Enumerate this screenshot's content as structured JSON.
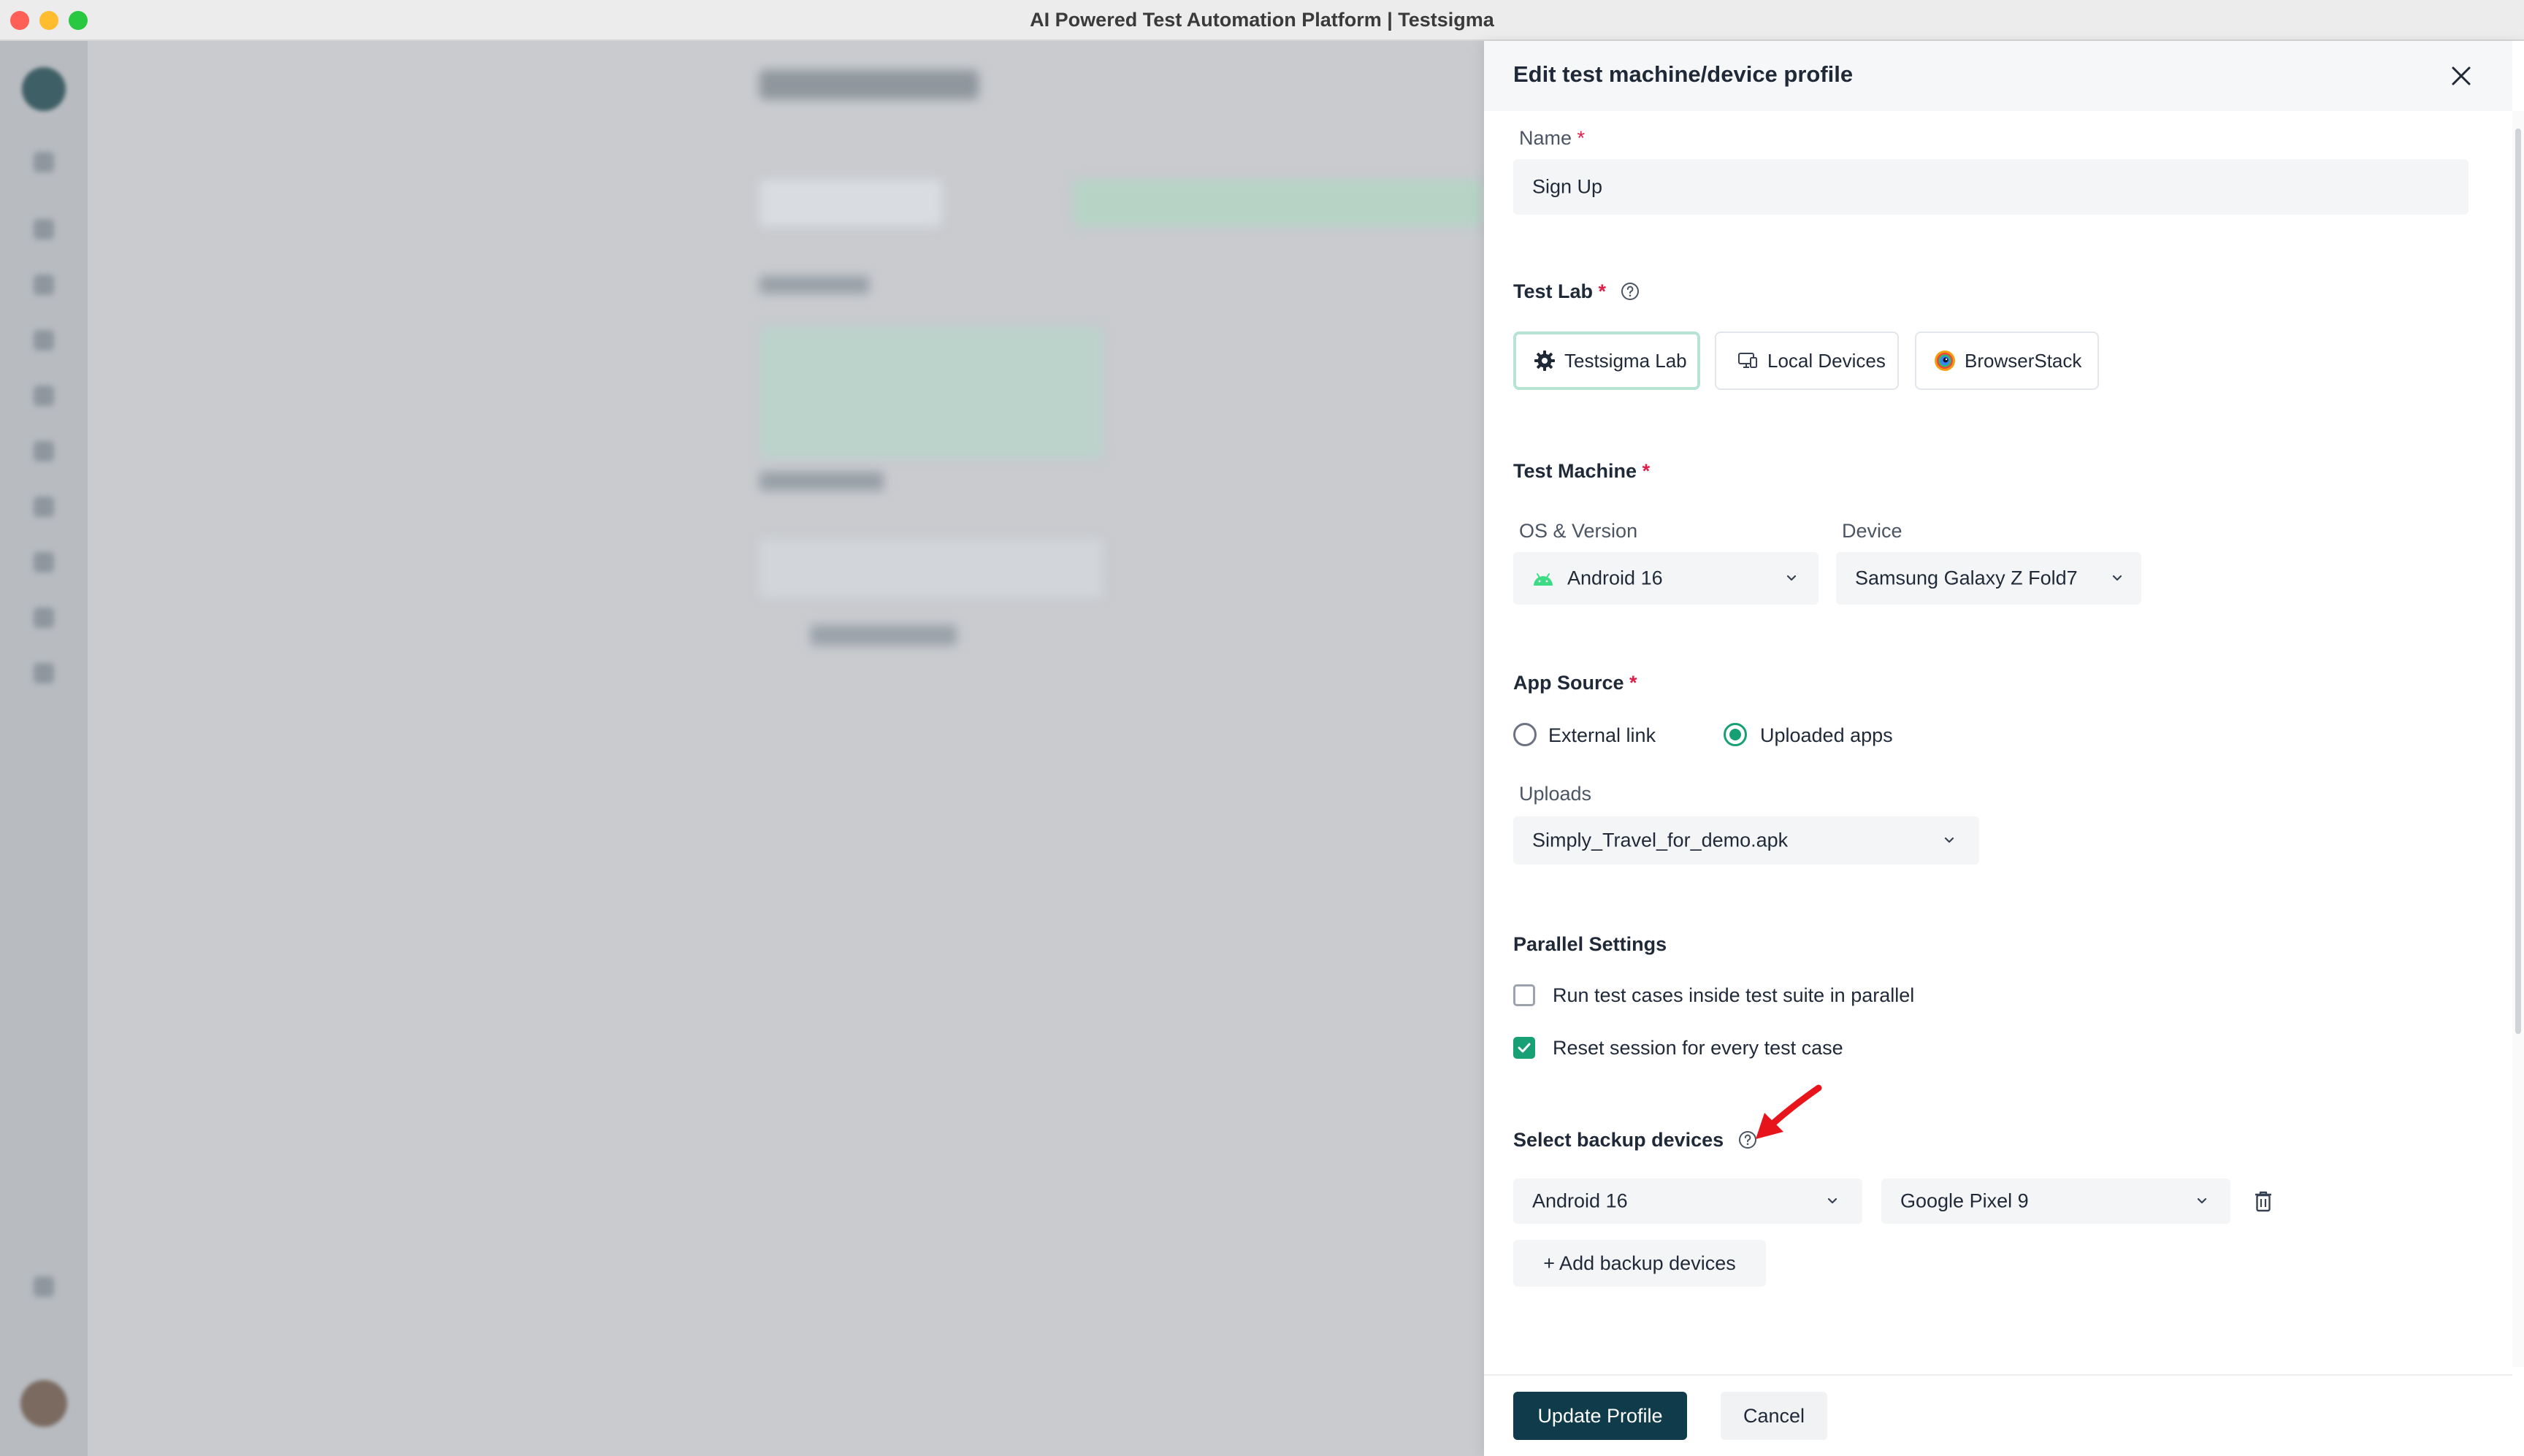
{
  "window": {
    "title": "AI Powered Test Automation Platform | Testsigma"
  },
  "drawer": {
    "title": "Edit test machine/device profile",
    "name_field": {
      "label": "Name",
      "required_mark": "*",
      "value": "Sign Up"
    },
    "test_lab": {
      "label": "Test Lab",
      "required_mark": "*",
      "options": [
        {
          "label": "Testsigma Lab",
          "icon": "gear-icon",
          "selected": true
        },
        {
          "label": "Local Devices",
          "icon": "monitor-icon",
          "selected": false
        },
        {
          "label": "BrowserStack",
          "icon": "browserstack-logo-icon",
          "selected": false
        }
      ]
    },
    "test_machine": {
      "label": "Test Machine",
      "required_mark": "*",
      "os_label": "OS & Version",
      "os_value": "Android 16",
      "device_label": "Device",
      "device_value": "Samsung Galaxy Z Fold7"
    },
    "app_source": {
      "label": "App Source",
      "required_mark": "*",
      "options": [
        {
          "label": "External link",
          "selected": false
        },
        {
          "label": "Uploaded apps",
          "selected": true
        }
      ],
      "uploads_label": "Uploads",
      "uploads_value": "Simply_Travel_for_demo.apk"
    },
    "parallel": {
      "label": "Parallel Settings",
      "options": [
        {
          "label": "Run test cases inside test suite in parallel",
          "checked": false
        },
        {
          "label": "Reset session for every test case",
          "checked": true
        }
      ]
    },
    "backup": {
      "label": "Select backup devices",
      "os_value": "Android 16",
      "device_value": "Google Pixel 9",
      "add_label": "+ Add backup devices"
    },
    "footer": {
      "primary_label": "Update Profile",
      "secondary_label": "Cancel"
    }
  },
  "colors": {
    "accent": "#17a074",
    "primary_button": "#0f3b4a",
    "required": "#e11d48",
    "annotation_arrow": "#e8141b"
  }
}
